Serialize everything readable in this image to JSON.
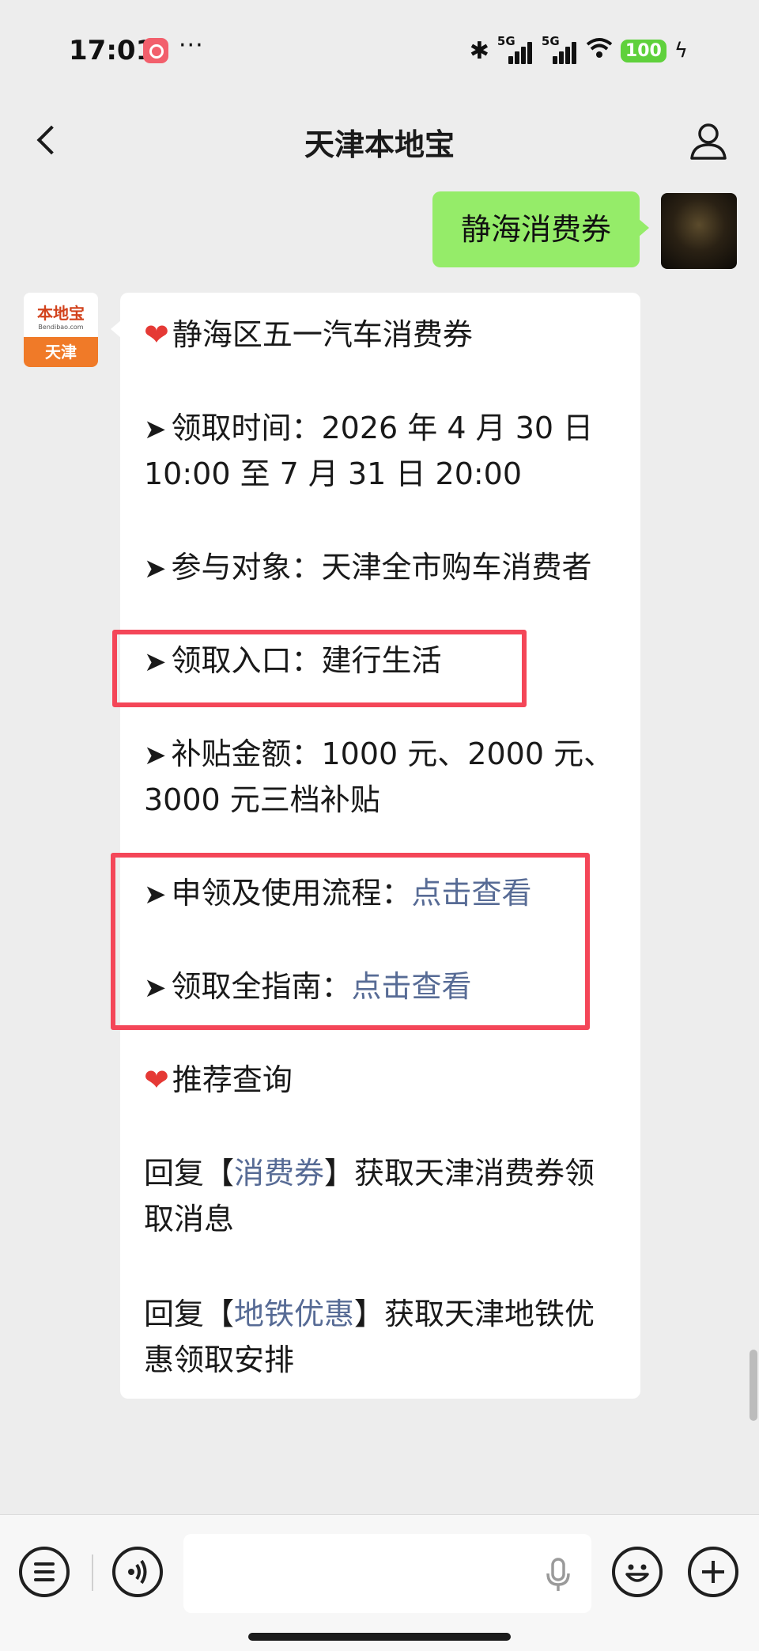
{
  "status_bar": {
    "time": "17:01",
    "dots": "···",
    "signal_label": "5G",
    "battery": "100"
  },
  "header": {
    "title": "天津本地宝",
    "back_icon": "chevron-left-icon",
    "profile_icon": "person-icon"
  },
  "sent_message": {
    "text": "静海消费券"
  },
  "received_avatar": {
    "logo_text": "本地宝",
    "logo_sub": "Bendibao.com",
    "city": "天津"
  },
  "received_message": {
    "heading": "静海区五一汽车消费券",
    "time_line1": "领取时间：2026 年 4 月 30 日",
    "time_line2": "10:00 至 7 月 31 日 20:00",
    "target": "参与对象：天津全市购车消费者",
    "entry": "领取入口：建行生活",
    "amount_line1": "补贴金额：1000 元、2000 元、",
    "amount_line2": "3000 元三档补贴",
    "process_label": "申领及使用流程：",
    "process_link": "点击查看",
    "guide_label": "领取全指南：",
    "guide_link": "点击查看",
    "recommend": "推荐查询",
    "reply1_prefix": "回复【",
    "reply1_keyword": "消费券",
    "reply1_suffix": "】获取天津消费券领",
    "reply1_line2": "取消息",
    "reply2_prefix": "回复【",
    "reply2_keyword": "地铁优惠",
    "reply2_suffix": "】获取天津地铁优",
    "reply2_line2": "惠领取安排",
    "highlight_color": "#f44658",
    "link_color": "#576b95"
  },
  "bottom_bar": {
    "icons": [
      "menu-list-icon",
      "voice-icon",
      "microphone-icon",
      "emoji-icon",
      "plus-icon"
    ],
    "input_value": ""
  }
}
